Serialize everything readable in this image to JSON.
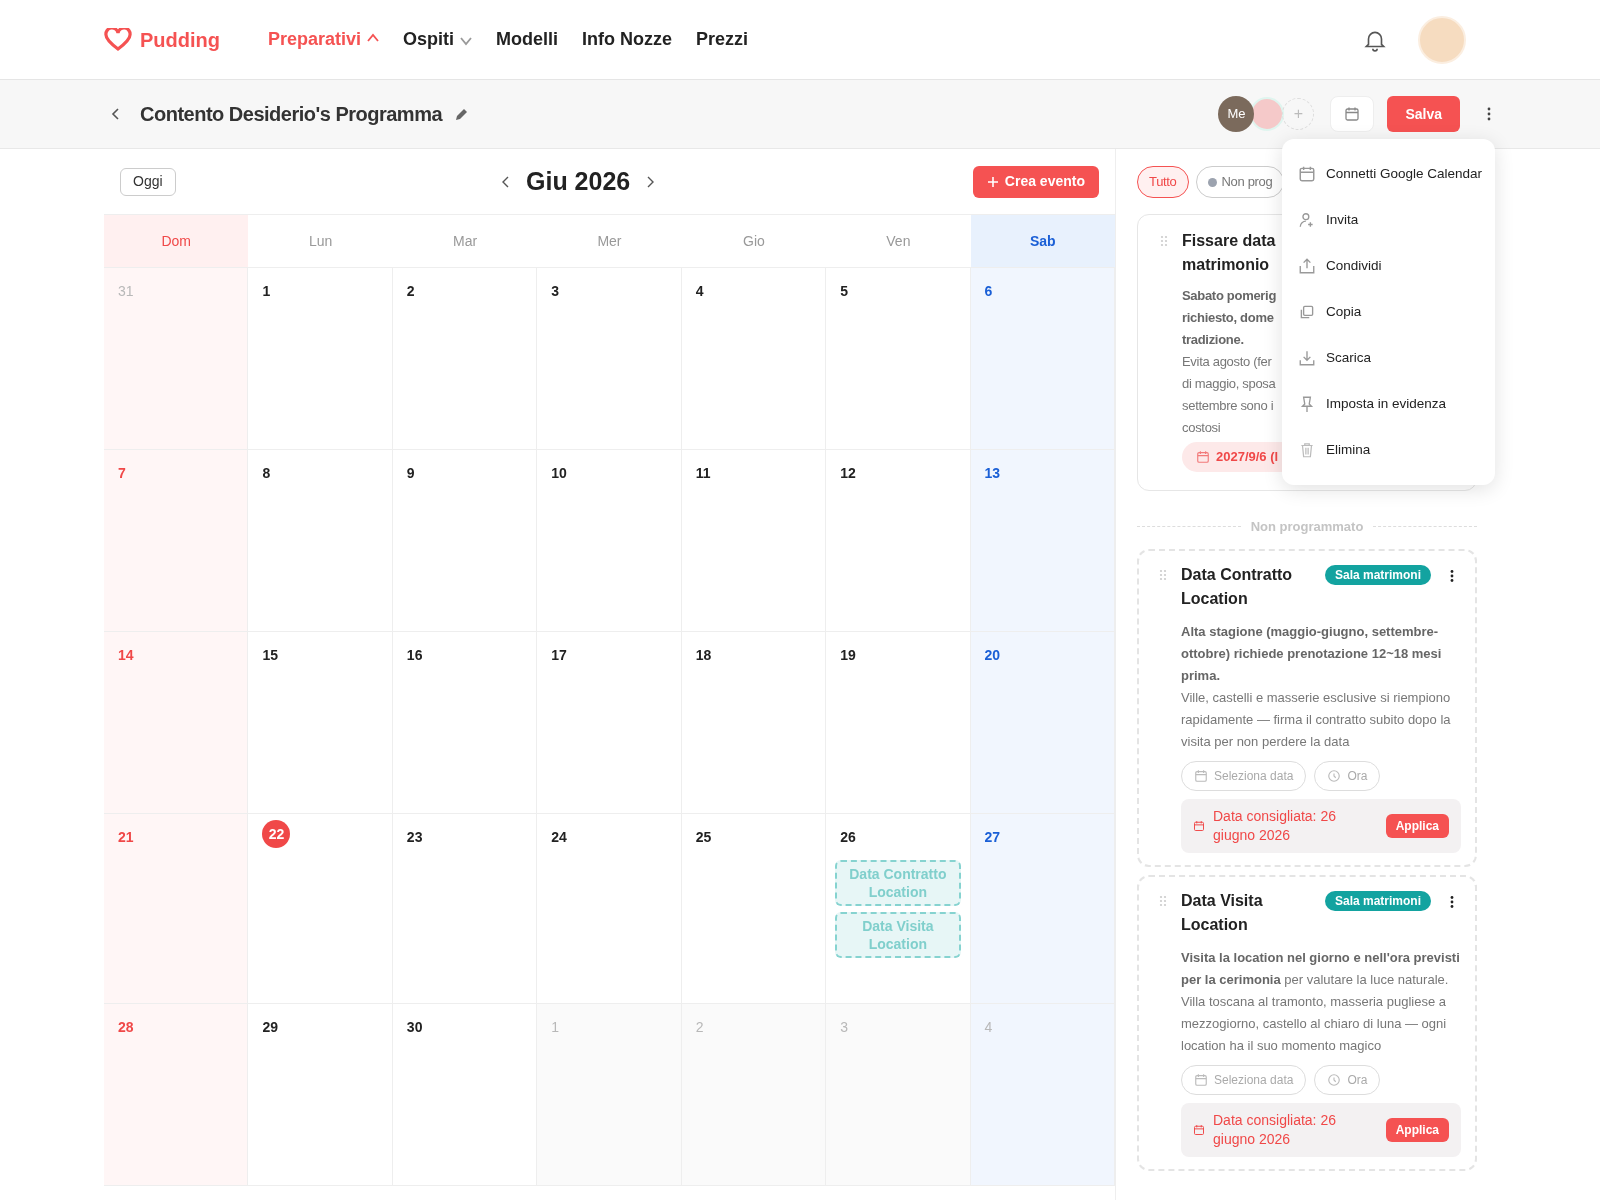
{
  "brand": {
    "name": "Pudding"
  },
  "nav": [
    {
      "label": "Preparativi",
      "selected": true,
      "dropdown": true,
      "expanded": true
    },
    {
      "label": "Ospiti",
      "selected": false,
      "dropdown": true,
      "expanded": false
    },
    {
      "label": "Modelli",
      "selected": false,
      "dropdown": false,
      "expanded": false
    },
    {
      "label": "Info Nozze",
      "selected": false,
      "dropdown": false,
      "expanded": false
    },
    {
      "label": "Prezzi",
      "selected": false,
      "dropdown": false,
      "expanded": false
    }
  ],
  "page_header": {
    "title": "Contento Desiderio's Programma",
    "members": [
      {
        "kind": "initials",
        "label": "Me"
      },
      {
        "kind": "avatar"
      }
    ],
    "add_member": "+",
    "save": "Salva"
  },
  "calendar": {
    "today_button": "Oggi",
    "month": "Giu 2026",
    "create_button": "Crea evento",
    "weekdays": [
      {
        "label": "Dom",
        "kind": "sunday"
      },
      {
        "label": "Lun",
        "kind": "weekday"
      },
      {
        "label": "Mar",
        "kind": "weekday"
      },
      {
        "label": "Mer",
        "kind": "weekday"
      },
      {
        "label": "Gio",
        "kind": "weekday"
      },
      {
        "label": "Ven",
        "kind": "weekday"
      },
      {
        "label": "Sab",
        "kind": "saturday"
      }
    ],
    "weeks": [
      [
        {
          "label": "31",
          "in_month": false,
          "today": false
        },
        {
          "label": "1",
          "in_month": true,
          "today": false
        },
        {
          "label": "2",
          "in_month": true,
          "today": false
        },
        {
          "label": "3",
          "in_month": true,
          "today": false
        },
        {
          "label": "4",
          "in_month": true,
          "today": false
        },
        {
          "label": "5",
          "in_month": true,
          "today": false
        },
        {
          "label": "6",
          "in_month": true,
          "today": false
        }
      ],
      [
        {
          "label": "7",
          "in_month": true,
          "today": false
        },
        {
          "label": "8",
          "in_month": true,
          "today": false
        },
        {
          "label": "9",
          "in_month": true,
          "today": false
        },
        {
          "label": "10",
          "in_month": true,
          "today": false
        },
        {
          "label": "11",
          "in_month": true,
          "today": false
        },
        {
          "label": "12",
          "in_month": true,
          "today": false
        },
        {
          "label": "13",
          "in_month": true,
          "today": false
        }
      ],
      [
        {
          "label": "14",
          "in_month": true,
          "today": false
        },
        {
          "label": "15",
          "in_month": true,
          "today": false
        },
        {
          "label": "16",
          "in_month": true,
          "today": false
        },
        {
          "label": "17",
          "in_month": true,
          "today": false
        },
        {
          "label": "18",
          "in_month": true,
          "today": false
        },
        {
          "label": "19",
          "in_month": true,
          "today": false
        },
        {
          "label": "20",
          "in_month": true,
          "today": false
        }
      ],
      [
        {
          "label": "21",
          "in_month": true,
          "today": false
        },
        {
          "label": "22",
          "in_month": true,
          "today": true
        },
        {
          "label": "23",
          "in_month": true,
          "today": false
        },
        {
          "label": "24",
          "in_month": true,
          "today": false
        },
        {
          "label": "25",
          "in_month": true,
          "today": false
        },
        {
          "label": "26",
          "in_month": true,
          "today": false,
          "events": [
            "Data Contratto Location",
            "Data Visita Location"
          ]
        },
        {
          "label": "27",
          "in_month": true,
          "today": false
        }
      ],
      [
        {
          "label": "28",
          "in_month": true,
          "today": false
        },
        {
          "label": "29",
          "in_month": true,
          "today": false
        },
        {
          "label": "30",
          "in_month": true,
          "today": false
        },
        {
          "label": "1",
          "in_month": false,
          "today": false
        },
        {
          "label": "2",
          "in_month": false,
          "today": false
        },
        {
          "label": "3",
          "in_month": false,
          "today": false
        },
        {
          "label": "4",
          "in_month": false,
          "today": false
        }
      ]
    ]
  },
  "side_panel": {
    "filters": [
      {
        "label": "Tutto",
        "selected": true
      },
      {
        "label": "Non prog",
        "selected": false,
        "color": "#9ca3af"
      }
    ],
    "scheduled_card": {
      "title": "Fissare data matrimonio",
      "lines": [
        {
          "text": "Sabato pomerig",
          "bold": true
        },
        {
          "text": "richiesto, dome",
          "bold": true
        },
        {
          "text": "tradizione.",
          "bold": true
        },
        {
          "text": "Evita agosto (fer",
          "bold": false
        },
        {
          "text": "di maggio, sposa",
          "bold": false
        },
        {
          "text": "settembre sono i",
          "bold": false
        },
        {
          "text": "costosi",
          "bold": false
        }
      ],
      "date_chip": "2027/9/6 (l"
    },
    "divider": "Non programmato",
    "tasks": [
      {
        "title": "Data Contratto Location",
        "tag": "Sala matrimoni",
        "color": "#13a3a0",
        "description": "**Alta stagione (maggio-giugno, settembre-ottobre) richiede prenotazione 12~18 mesi prima.**\nVille, castelli e masserie esclusive si riempiono rapidamente — firma il contratto subito dopo la visita per non perdere la data",
        "date_button": "Seleziona data",
        "time_button": "Ora",
        "suggestion": "Data consigliata: 26 giugno 2026",
        "apply": "Applica"
      },
      {
        "title": "Data Visita Location",
        "tag": "Sala matrimoni",
        "color": "#13a3a0",
        "description": "**Visita la location nel giorno e nell'ora previsti per la cerimonia** per valutare la luce naturale. Villa toscana al tramonto, masseria pugliese a mezzogiorno, castello al chiaro di luna — ogni location ha il suo momento magico",
        "date_button": "Seleziona data",
        "time_button": "Ora",
        "suggestion": "Data consigliata: 26 giugno 2026",
        "apply": "Applica"
      }
    ]
  },
  "menu": [
    {
      "label": "Connetti Google Calendar",
      "kind": "calendar"
    },
    {
      "label": "Invita",
      "kind": "invite"
    },
    {
      "label": "Condividi",
      "kind": "share"
    },
    {
      "label": "Copia",
      "kind": "copy"
    },
    {
      "label": "Scarica",
      "kind": "download"
    },
    {
      "label": "Imposta in evidenza",
      "kind": "pin"
    },
    {
      "label": "Elimina",
      "kind": "delete"
    }
  ]
}
